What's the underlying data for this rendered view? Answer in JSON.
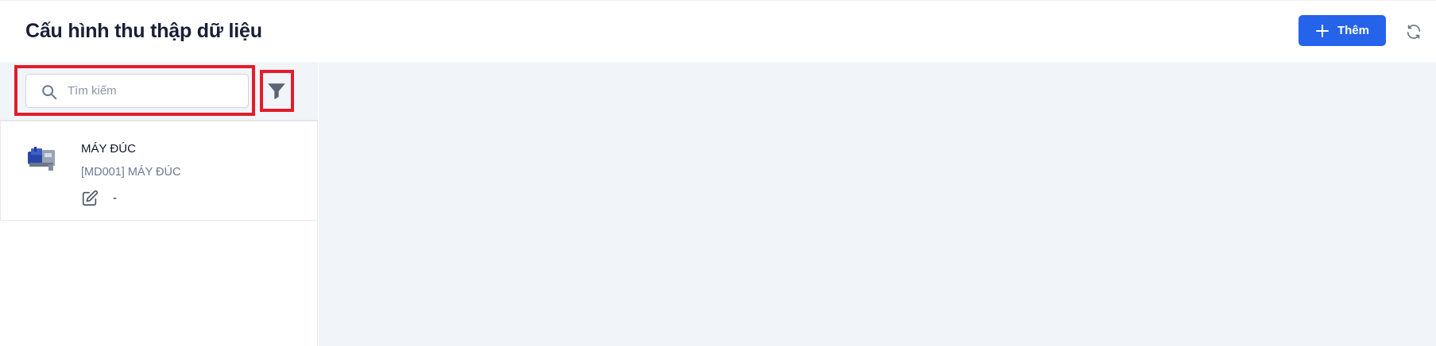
{
  "header": {
    "title": "Cấu hình thu thập dữ liệu",
    "add_label": "Thêm",
    "accent_color": "#2563eb"
  },
  "icons": {
    "add": "plus-icon",
    "refresh": "refresh-icon",
    "search": "search-icon",
    "filter": "filter-icon",
    "edit": "edit-icon"
  },
  "sidebar": {
    "search": {
      "placeholder": "Tìm kiếm",
      "value": ""
    },
    "highlight_color": "#e11d2a",
    "items": [
      {
        "name": "MÁY ĐÚC",
        "code": "[MD001] MÁY ĐÚC",
        "value": "-"
      }
    ]
  }
}
